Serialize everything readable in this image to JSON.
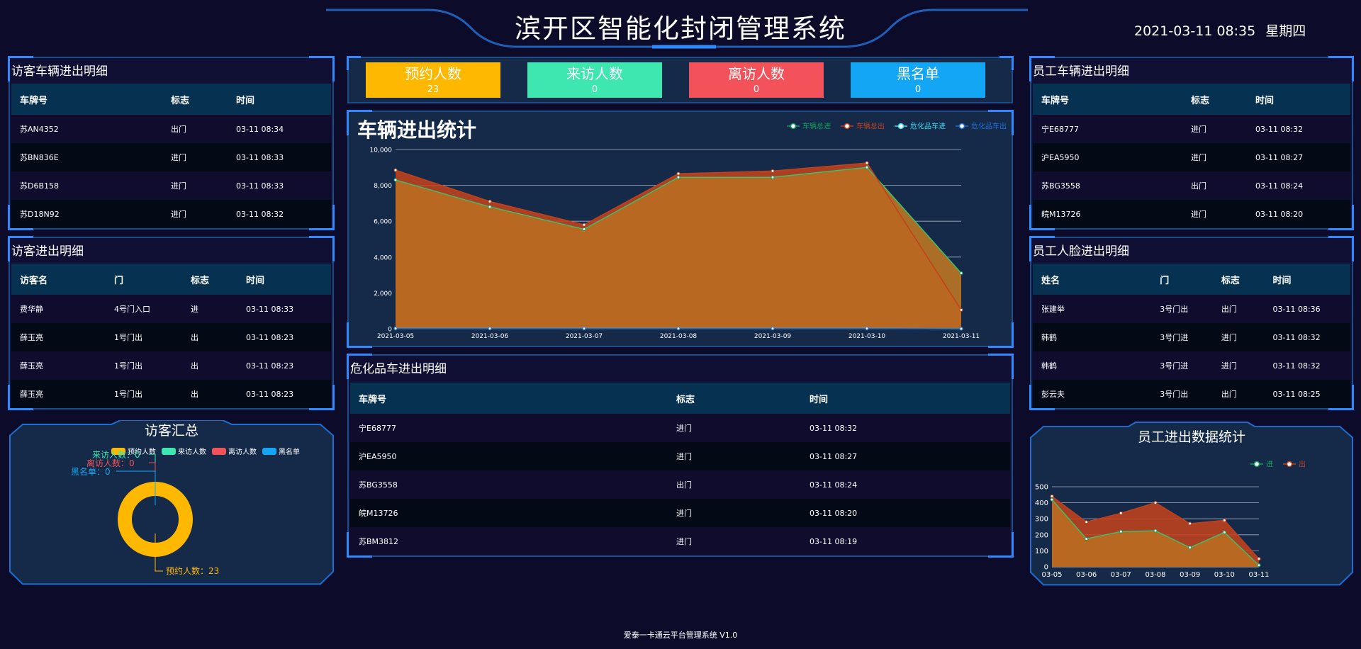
{
  "header": {
    "title": "滨开区智能化封闭管理系统",
    "datetime": "2021-03-11 08:35",
    "weekday": "星期四"
  },
  "visitor_vehicles": {
    "title": "访客车辆进出明细",
    "columns": [
      "车牌号",
      "标志",
      "时间"
    ],
    "rows": [
      [
        "苏AN4352",
        "出门",
        "03-11 08:34"
      ],
      [
        "苏BN836E",
        "进门",
        "03-11 08:33"
      ],
      [
        "苏D6B158",
        "进门",
        "03-11 08:33"
      ],
      [
        "苏D18N92",
        "进门",
        "03-11 08:32"
      ]
    ]
  },
  "visitor_access": {
    "title": "访客进出明细",
    "columns": [
      "访客名",
      "门",
      "标志",
      "时间"
    ],
    "rows": [
      [
        "费华静",
        "4号门入口",
        "进",
        "03-11 08:33"
      ],
      [
        "薛玉亮",
        "1号门出",
        "出",
        "03-11 08:23"
      ],
      [
        "薛玉亮",
        "1号门出",
        "出",
        "03-11 08:23"
      ],
      [
        "薛玉亮",
        "1号门出",
        "出",
        "03-11 08:23"
      ]
    ]
  },
  "visitor_summary": {
    "title": "访客汇总",
    "legend": [
      "预约人数",
      "来访人数",
      "离访人数",
      "黑名单"
    ],
    "colors": [
      "#ffb800",
      "#3ee6b0",
      "#f4525a",
      "#13a6f5"
    ],
    "labels": {
      "booked": "预约人数：23",
      "visiting": "来访人数：0",
      "left": "离访人数：0",
      "blacklist": "黑名单：0"
    },
    "values": [
      23,
      0,
      0,
      0
    ]
  },
  "stats": [
    {
      "label": "预约人数",
      "value": "23",
      "color": "#ffb800"
    },
    {
      "label": "来访人数",
      "value": "0",
      "color": "#3ee6b0"
    },
    {
      "label": "离访人数",
      "value": "0",
      "color": "#f4525a"
    },
    {
      "label": "黑名单",
      "value": "0",
      "color": "#13a6f5"
    }
  ],
  "dangerous_vehicles": {
    "title": "危化品车进出明细",
    "columns": [
      "车牌号",
      "标志",
      "时间"
    ],
    "rows": [
      [
        "宁E68777",
        "进门",
        "03-11 08:32"
      ],
      [
        "沪EA5950",
        "进门",
        "03-11 08:27"
      ],
      [
        "苏BG3558",
        "出门",
        "03-11 08:24"
      ],
      [
        "皖M13726",
        "进门",
        "03-11 08:20"
      ],
      [
        "苏BM3812",
        "进门",
        "03-11 08:19"
      ]
    ]
  },
  "staff_vehicles": {
    "title": "员工车辆进出明细",
    "columns": [
      "车牌号",
      "标志",
      "时间"
    ],
    "rows": [
      [
        "宁E68777",
        "进门",
        "03-11 08:32"
      ],
      [
        "沪EA5950",
        "进门",
        "03-11 08:27"
      ],
      [
        "苏BG3558",
        "出门",
        "03-11 08:24"
      ],
      [
        "皖M13726",
        "进门",
        "03-11 08:20"
      ]
    ]
  },
  "staff_faces": {
    "title": "员工人脸进出明细",
    "columns": [
      "姓名",
      "门",
      "标志",
      "时间"
    ],
    "rows": [
      [
        "张建举",
        "3号门出",
        "出门",
        "03-11 08:36"
      ],
      [
        "韩鹤",
        "3号门进",
        "进门",
        "03-11 08:32"
      ],
      [
        "韩鹤",
        "3号门进",
        "进门",
        "03-11 08:32"
      ],
      [
        "彭云夫",
        "3号门出",
        "出门",
        "03-11 08:25"
      ]
    ]
  },
  "chart_data": [
    {
      "type": "area",
      "title": "车辆进出统计",
      "categories": [
        "2021-03-05",
        "2021-03-06",
        "2021-03-07",
        "2021-03-08",
        "2021-03-09",
        "2021-03-10",
        "2021-03-11"
      ],
      "ylim": [
        0,
        10000
      ],
      "yticks": [
        "0",
        "2,000",
        "4,000",
        "6,000",
        "8,000",
        "10,000"
      ],
      "grid": true,
      "legend_position": "top-right",
      "series": [
        {
          "name": "车辆总进",
          "color": "#0fa05e",
          "values": [
            8300,
            6800,
            5550,
            8450,
            8450,
            9000,
            3100
          ]
        },
        {
          "name": "车辆总出",
          "color": "#c2411c",
          "values": [
            8850,
            7100,
            5800,
            8650,
            8800,
            9250,
            1050
          ]
        },
        {
          "name": "危化品车进",
          "color": "#38d9f0",
          "values": [
            20,
            20,
            20,
            20,
            20,
            20,
            0
          ]
        },
        {
          "name": "危化品车出",
          "color": "#1f6fd6",
          "values": [
            15,
            15,
            15,
            15,
            15,
            15,
            0
          ]
        }
      ]
    },
    {
      "type": "area",
      "title": "员工进出数据统计",
      "categories": [
        "03-05",
        "03-06",
        "03-07",
        "03-08",
        "03-09",
        "03-10",
        "03-11"
      ],
      "ylim": [
        0,
        500
      ],
      "yticks": [
        "0",
        "100",
        "200",
        "300",
        "400",
        "500"
      ],
      "grid": true,
      "legend_position": "top-right",
      "series": [
        {
          "name": "进",
          "color": "#0fa05e",
          "values": [
            420,
            175,
            220,
            225,
            120,
            215,
            10
          ]
        },
        {
          "name": "出",
          "color": "#c2411c",
          "values": [
            440,
            280,
            335,
            400,
            270,
            290,
            50
          ]
        }
      ]
    }
  ],
  "footer": "爱泰一卡通云平台管理系统 V1.0"
}
